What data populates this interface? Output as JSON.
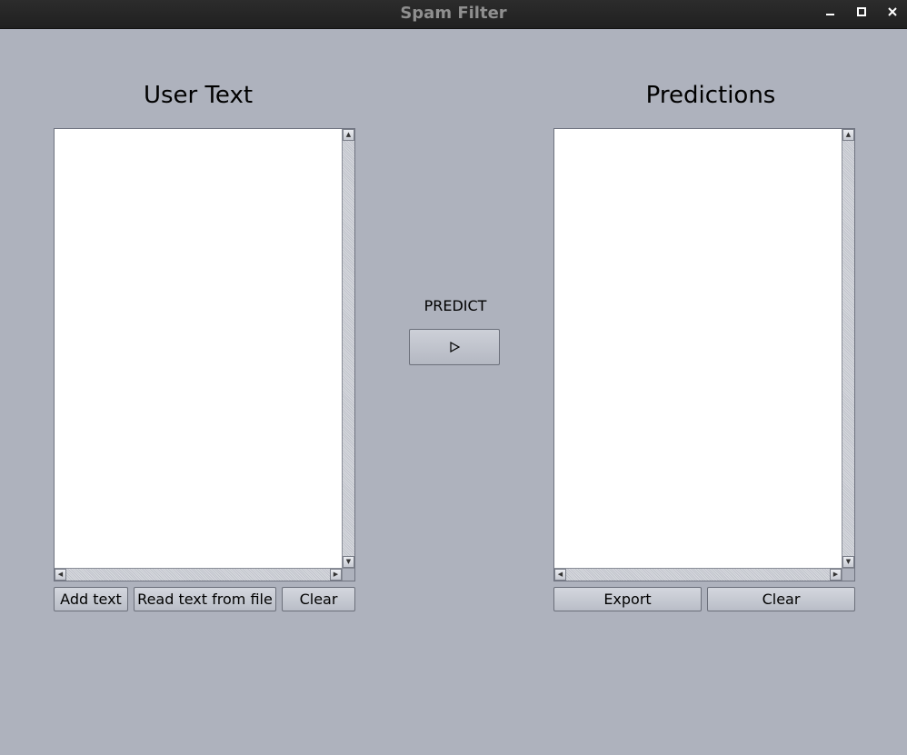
{
  "window": {
    "title": "Spam Filter",
    "controls": [
      "minimize-icon",
      "maximize-icon",
      "close-icon"
    ]
  },
  "left_panel": {
    "heading": "User Text",
    "textarea_value": "",
    "buttons": {
      "add_text": "Add text",
      "read_file": "Read text from file",
      "clear": "Clear"
    }
  },
  "center": {
    "predict_label": "PREDICT",
    "predict_icon": "play-icon"
  },
  "right_panel": {
    "heading": "Predictions",
    "textarea_value": "",
    "buttons": {
      "export": "Export",
      "clear": "Clear"
    }
  }
}
